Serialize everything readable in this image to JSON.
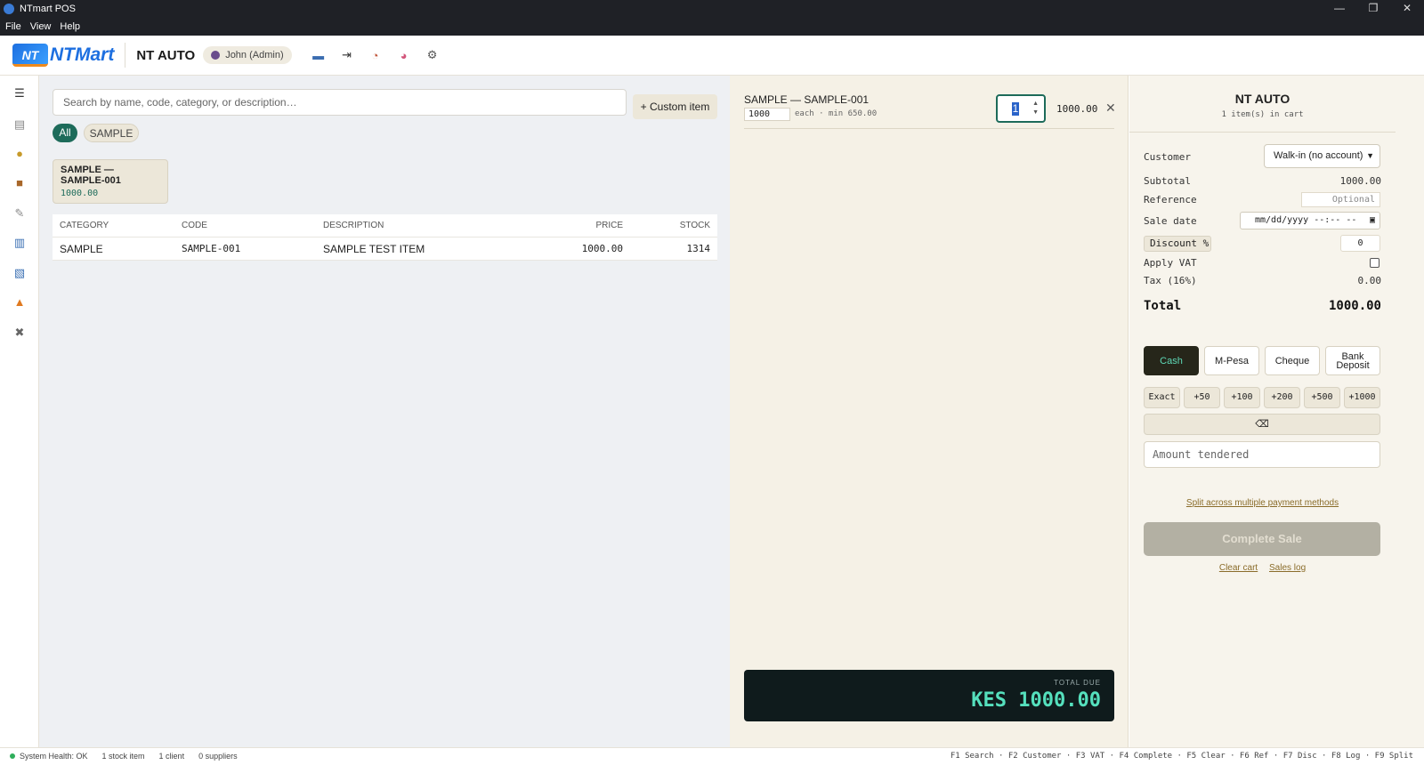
{
  "window": {
    "title": "NTmart POS",
    "controls": [
      "—",
      "❐",
      "✕"
    ]
  },
  "menu": [
    "File",
    "View",
    "Help"
  ],
  "header": {
    "logo_mark": "NT",
    "logo_word": "NTMart",
    "store_name": "NT AUTO",
    "user": "John (Admin)",
    "icons": [
      "card-icon",
      "logout-icon",
      "clock-icon",
      "palette-icon",
      "settings-icon"
    ]
  },
  "sidebar": [
    "menu-icon",
    "receipt-icon",
    "money-bag-icon",
    "box-icon",
    "wrench-icon",
    "bar-chart-icon",
    "line-chart-icon",
    "cone-icon",
    "tools-icon"
  ],
  "products": {
    "search_placeholder": "Search by name, code, category, or description…",
    "custom_item_label": "+ Custom item",
    "chips": [
      "All",
      "SAMPLE"
    ],
    "card": {
      "title": "SAMPLE — SAMPLE-001",
      "price": "1000.00"
    },
    "columns": [
      "CATEGORY",
      "CODE",
      "DESCRIPTION",
      "PRICE",
      "STOCK"
    ],
    "rows": [
      {
        "category": "SAMPLE",
        "code": "SAMPLE-001",
        "description": "SAMPLE TEST ITEM",
        "price": "1000.00",
        "stock": "1314"
      }
    ]
  },
  "cart": {
    "line": {
      "name": "SAMPLE — SAMPLE-001",
      "unit_price": "1000",
      "min_note": "each · min 650.00",
      "qty": "1",
      "line_total": "1000.00",
      "remove": "✕"
    },
    "total_due_label": "TOTAL DUE",
    "total_due_value": "KES 1000.00"
  },
  "checkout": {
    "title": "NT AUTO",
    "subtitle": "1 item(s) in cart",
    "customer_label": "Customer",
    "customer_value": "Walk-in (no account)",
    "subtotal_label": "Subtotal",
    "subtotal_value": "1000.00",
    "reference_label": "Reference",
    "reference_placeholder": "Optional",
    "sale_date_label": "Sale date",
    "sale_date_value": "mm/dd/yyyy --:-- --",
    "discount_label": "Discount %",
    "discount_value": "0",
    "vat_label": "Apply VAT",
    "tax_label": "Tax (16%)",
    "tax_value": "0.00",
    "total_label": "Total",
    "total_value": "1000.00",
    "payment_methods": [
      "Cash",
      "M-Pesa",
      "Cheque",
      "Bank Deposit"
    ],
    "quick_amounts": [
      "Exact",
      "+50",
      "+100",
      "+200",
      "+500",
      "+1000"
    ],
    "backspace": "⌫",
    "tendered_placeholder": "Amount tendered",
    "split_link": "Split across multiple payment methods",
    "complete_label": "Complete Sale",
    "clear_cart": "Clear cart",
    "sales_log": "Sales log"
  },
  "status": {
    "health": "System Health: OK",
    "stock": "1 stock item",
    "clients": "1 client",
    "suppliers": "0 suppliers",
    "shortcuts": "F1 Search · F2 Customer · F3 VAT · F4 Complete · F5 Clear · F6 Ref · F7 Disc · F8 Log · F9 Split"
  }
}
